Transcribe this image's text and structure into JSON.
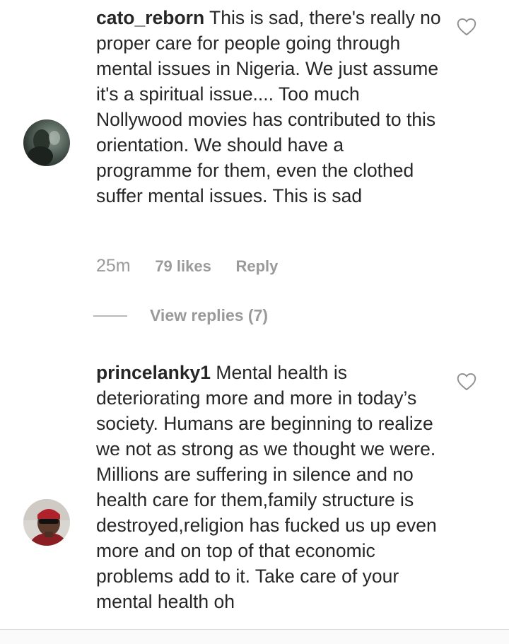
{
  "comments": [
    {
      "username": "cato_reborn",
      "text": "This is sad, there's really no proper care for people going through mental issues in Nigeria. We just assume it's a spiritual issue.... Too much Nollywood movies has contributed to this orientation. We should have a programme for them, even the clothed suffer mental issues. This is sad",
      "time": "25m",
      "likes": "79 likes",
      "reply": "Reply",
      "view_replies": "View replies (7)"
    },
    {
      "username": "princelanky1",
      "text": "Mental health is deteriorating more and more in today’s society. Humans are beginning to realize we not as strong as we thought we were. Millions are suffering in silence and no health care for them,family structure is destroyed,religion has fucked us up even more and on top of that economic problems add to it. Take care of your mental health oh"
    }
  ],
  "colors": {
    "text": "#262626",
    "secondary": "#9a9a9a"
  },
  "icons": {
    "like": "heart-outline-icon"
  }
}
